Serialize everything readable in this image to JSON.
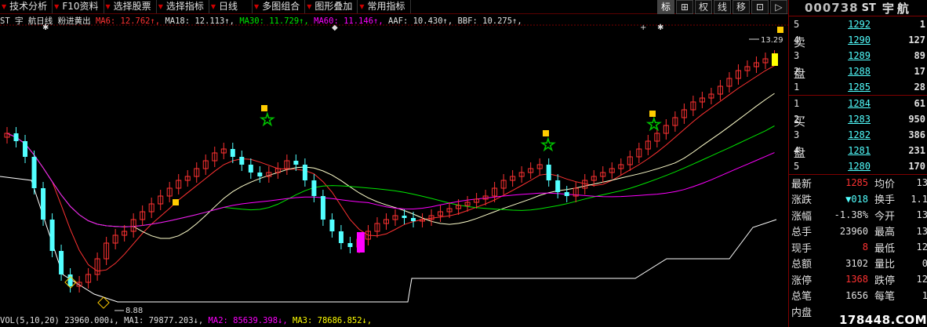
{
  "menu": [
    {
      "label": "技术分析"
    },
    {
      "label": "F10资料"
    },
    {
      "label": "选择股票"
    },
    {
      "label": "选择指标"
    },
    {
      "label": "日线"
    },
    {
      "label": "多图组合"
    },
    {
      "label": "图形叠加"
    },
    {
      "label": "常用指标"
    }
  ],
  "tools": [
    "标",
    "⊞",
    "权",
    "线",
    "移",
    "⊡",
    "▷"
  ],
  "indicator": {
    "title": "ST 宇 航日线",
    "formula": "粉进黄出",
    "ma6": "MA6: 12.762↑,",
    "ma18": "MA18: 12.113↑,",
    "ma30": "MA30: 11.729↑,",
    "ma60": "MA60: 11.146↑,",
    "aaf": "AAF: 10.430↑,",
    "bbf": "BBF: 10.275↑,"
  },
  "chart_labels": {
    "high": "13.29",
    "low": "8.88"
  },
  "volume": {
    "label": "VOL(5,10,20)",
    "vol": "23960.000↓,",
    "ma1": "MA1: 79877.203↓,",
    "ma2": "MA2: 85639.398↓,",
    "ma3": "MA3: 78686.852↓,"
  },
  "stock": {
    "code": "000738",
    "st": "ST",
    "name": "宇航"
  },
  "sell_label": [
    "卖",
    "盘"
  ],
  "buy_label": [
    "买",
    "盘"
  ],
  "sell": [
    {
      "lvl": "5",
      "price": "1292",
      "vol": "1"
    },
    {
      "lvl": "4",
      "price": "1290",
      "vol": "127"
    },
    {
      "lvl": "3",
      "price": "1289",
      "vol": "89"
    },
    {
      "lvl": "2",
      "price": "1288",
      "vol": "17"
    },
    {
      "lvl": "1",
      "price": "1285",
      "vol": "28"
    }
  ],
  "buy": [
    {
      "lvl": "1",
      "price": "1284",
      "vol": "61"
    },
    {
      "lvl": "2",
      "price": "1283",
      "vol": "950"
    },
    {
      "lvl": "3",
      "price": "1282",
      "vol": "386"
    },
    {
      "lvl": "4",
      "price": "1281",
      "vol": "231"
    },
    {
      "lvl": "5",
      "price": "1280",
      "vol": "170"
    }
  ],
  "stats": [
    {
      "k1": "最新",
      "v1": "1285",
      "c1": "red",
      "k2": "均价",
      "v2": "13"
    },
    {
      "k1": "涨跌",
      "v1": "▼018",
      "c1": "cyan",
      "k2": "换手",
      "v2": "1.1"
    },
    {
      "k1": "涨幅",
      "v1": "-1.38%",
      "c1": "white",
      "k2": "今开",
      "v2": "13"
    },
    {
      "k1": "总手",
      "v1": "23960",
      "c1": "white",
      "k2": "最高",
      "v2": "13"
    },
    {
      "k1": "现手",
      "v1": "8",
      "c1": "red",
      "k2": "最低",
      "v2": "12"
    },
    {
      "k1": "总额",
      "v1": "3102",
      "c1": "white",
      "k2": "量比",
      "v2": "0"
    },
    {
      "k1": "涨停",
      "v1": "1368",
      "c1": "red",
      "k2": "跌停",
      "v2": "12"
    },
    {
      "k1": "总笔",
      "v1": "1656",
      "c1": "white",
      "k2": "每笔",
      "v2": "1"
    },
    {
      "k1": "内盘",
      "v1": "",
      "c1": "white",
      "k2": "",
      "v2": ""
    }
  ],
  "watermark": "178448.COM",
  "colors": {
    "up": "#ff3232",
    "down": "#52ffff",
    "ma6": "#ff3232",
    "ma18": "#ffffff",
    "ma30": "#00e600",
    "ma60": "#ff00ff"
  }
}
